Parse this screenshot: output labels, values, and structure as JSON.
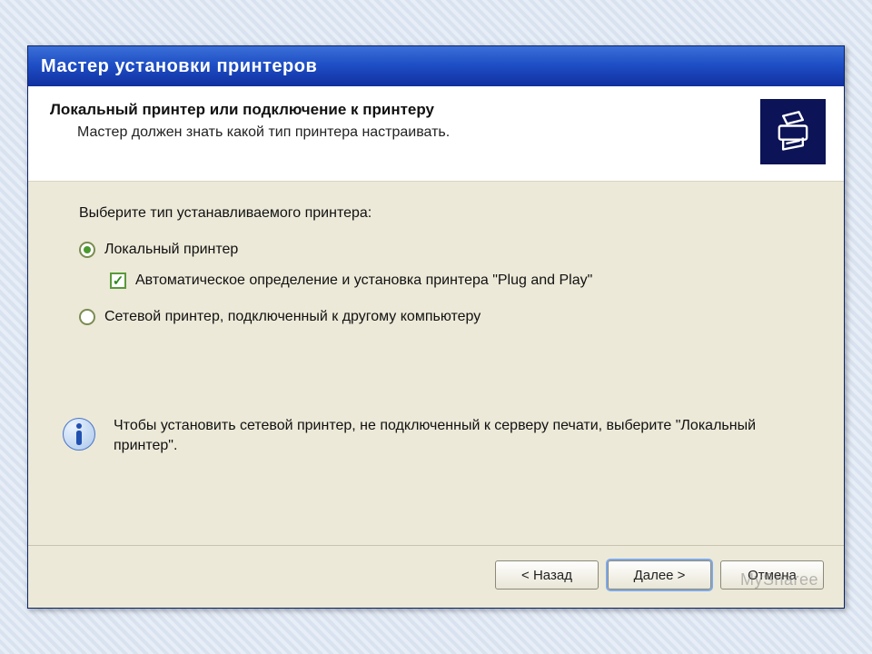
{
  "window": {
    "title": "Мастер установки принтеров"
  },
  "header": {
    "title": "Локальный принтер или подключение к принтеру",
    "subtitle": "Мастер должен знать какой тип принтера настраивать.",
    "icon": "printer-icon"
  },
  "content": {
    "prompt": "Выберите тип устанавливаемого принтера:",
    "option_local": {
      "label": "Локальный принтер",
      "selected": true
    },
    "option_autodetect": {
      "label": "Автоматическое определение и установка принтера \"Plug and Play\"",
      "checked": true
    },
    "option_network": {
      "label": "Сетевой принтер, подключенный к другому компьютеру",
      "selected": false
    },
    "info": "Чтобы установить сетевой принтер, не подключенный к серверу печати, выберите \"Локальный принтер\"."
  },
  "buttons": {
    "back": "< Назад",
    "next": "Далее >",
    "cancel": "Отмена"
  },
  "watermark": "MySharee",
  "colors": {
    "titlebar_gradient_top": "#3b6fd7",
    "titlebar_gradient_bottom": "#1030a0",
    "body_bg": "#ece9d8",
    "header_icon_bg": "#0c1356",
    "radio_checked": "#4a9a2f"
  }
}
